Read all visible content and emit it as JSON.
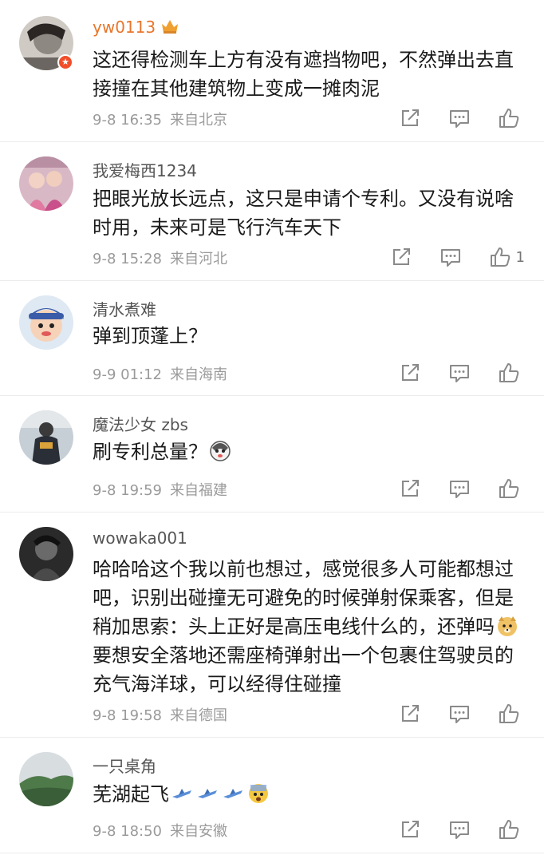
{
  "comments": [
    {
      "username": "yw0113",
      "text": "这还得检测车上方有没有遮挡物吧，不然弹出去直接撞在其他建筑物上变成一摊肉泥",
      "time": "9-8 16:35",
      "location": "来自北京",
      "likes": ""
    },
    {
      "username": "我爱梅西1234",
      "text": "把眼光放长远点，这只是申请个专利。又没有说啥时用，未来可是飞行汽车天下",
      "time": "9-8 15:28",
      "location": "来自河北",
      "likes": "1"
    },
    {
      "username": "清水煮难",
      "text": "弹到顶蓬上？",
      "time": "9-9 01:12",
      "location": "来自海南",
      "likes": ""
    },
    {
      "username": "魔法少女 zbs",
      "text": "刷专利总量？",
      "time": "9-8 19:59",
      "location": "来自福建",
      "likes": ""
    },
    {
      "username": "wowaka001",
      "text_a": "哈哈哈这个我以前也想过，感觉很多人可能都想过吧，识别出碰撞无可避免的时候弹射保乘客，但是稍加思索：头上正好是高压电线什么的，还弹吗",
      "text_b": "要想安全落地还需座椅弹射出一个包裹住驾驶员的充气海洋球，可以经得住碰撞",
      "time": "9-8 19:58",
      "location": "来自德国",
      "likes": ""
    },
    {
      "username": "一只桌角",
      "text": "芜湖起飞",
      "time": "9-8 18:50",
      "location": "来自安徽",
      "likes": ""
    }
  ],
  "icons": {
    "share": "share-icon",
    "reply": "comment-icon",
    "like": "thumbs-up-icon"
  },
  "colors": {
    "vip_username": "#e8762c",
    "meta": "#9a9a9a",
    "divider": "#ececec"
  }
}
